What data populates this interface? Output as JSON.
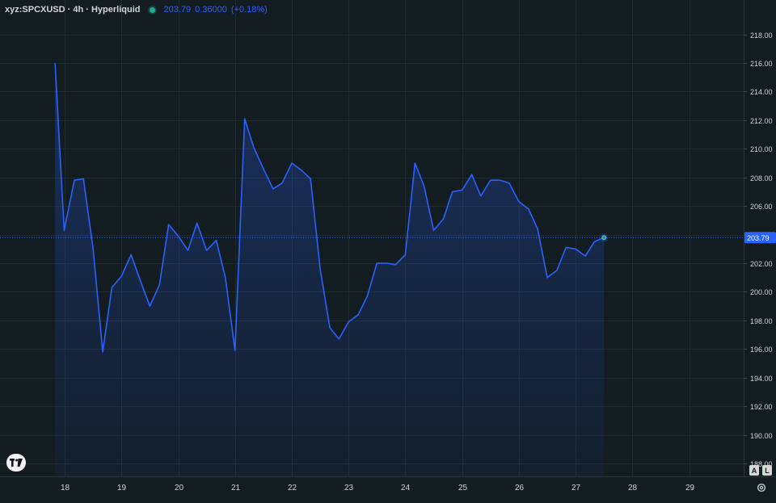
{
  "legend": {
    "symbol": "xyz:SPCXUSD · 4h · Hyperliquid",
    "last": "203.79",
    "change": "0.36000",
    "change_pct": "(+0.18%)"
  },
  "price_label": "203.79",
  "scale_buttons": {
    "auto": "A",
    "log": "L"
  },
  "icons": {
    "logo": "tradingview-logo-icon",
    "settings": "gear-icon",
    "status": "market-status-dot-icon"
  },
  "colors": {
    "background": "#131c21",
    "line": "#2962ff",
    "grid": "#1f2a30",
    "axis_text": "#d1d4dc",
    "status_dot": "#22ab94"
  },
  "chart_data": {
    "type": "area",
    "y_axis": {
      "ticks": [
        "188.00",
        "190.00",
        "192.00",
        "194.00",
        "196.00",
        "198.00",
        "200.00",
        "202.00",
        "204.00",
        "206.00",
        "208.00",
        "210.00",
        "212.00",
        "214.00",
        "216.00",
        "218.00"
      ],
      "ylim": [
        187.1,
        220.4
      ]
    },
    "x_axis": {
      "ticks": [
        "18",
        "19",
        "20",
        "21",
        "22",
        "23",
        "24",
        "25",
        "26",
        "27",
        "28",
        "29"
      ],
      "xlim": [
        16.86,
        29.96
      ]
    },
    "current_price": 203.79,
    "grid": true,
    "series": [
      {
        "points": [
          [
            17.83,
            216.0
          ],
          [
            17.99,
            204.3
          ],
          [
            18.17,
            207.8
          ],
          [
            18.33,
            207.9
          ],
          [
            18.5,
            203.0
          ],
          [
            18.67,
            195.8
          ],
          [
            18.83,
            200.3
          ],
          [
            19.0,
            201.1
          ],
          [
            19.17,
            202.6
          ],
          [
            19.33,
            200.8
          ],
          [
            19.5,
            199.0
          ],
          [
            19.67,
            200.5
          ],
          [
            19.83,
            204.7
          ],
          [
            20.0,
            203.9
          ],
          [
            20.17,
            202.9
          ],
          [
            20.33,
            204.8
          ],
          [
            20.5,
            202.9
          ],
          [
            20.67,
            203.6
          ],
          [
            20.83,
            201.0
          ],
          [
            21.0,
            195.9
          ],
          [
            21.17,
            212.1
          ],
          [
            21.33,
            210.1
          ],
          [
            21.5,
            208.6
          ],
          [
            21.67,
            207.2
          ],
          [
            21.83,
            207.6
          ],
          [
            22.0,
            209.0
          ],
          [
            22.17,
            208.5
          ],
          [
            22.33,
            207.9
          ],
          [
            22.5,
            201.6
          ],
          [
            22.67,
            197.5
          ],
          [
            22.83,
            196.7
          ],
          [
            23.0,
            197.9
          ],
          [
            23.17,
            198.4
          ],
          [
            23.33,
            199.7
          ],
          [
            23.5,
            202.0
          ],
          [
            23.67,
            202.0
          ],
          [
            23.83,
            201.9
          ],
          [
            24.0,
            202.6
          ],
          [
            24.17,
            209.0
          ],
          [
            24.33,
            207.4
          ],
          [
            24.5,
            204.3
          ],
          [
            24.67,
            205.1
          ],
          [
            24.83,
            207.0
          ],
          [
            25.0,
            207.1
          ],
          [
            25.17,
            208.2
          ],
          [
            25.33,
            206.7
          ],
          [
            25.5,
            207.8
          ],
          [
            25.67,
            207.8
          ],
          [
            25.83,
            207.6
          ],
          [
            26.0,
            206.3
          ],
          [
            26.17,
            205.8
          ],
          [
            26.33,
            204.4
          ],
          [
            26.5,
            201.0
          ],
          [
            26.67,
            201.5
          ],
          [
            26.83,
            203.1
          ],
          [
            27.0,
            203.0
          ],
          [
            27.17,
            202.5
          ],
          [
            27.33,
            203.5
          ],
          [
            27.5,
            203.79
          ]
        ]
      }
    ]
  }
}
